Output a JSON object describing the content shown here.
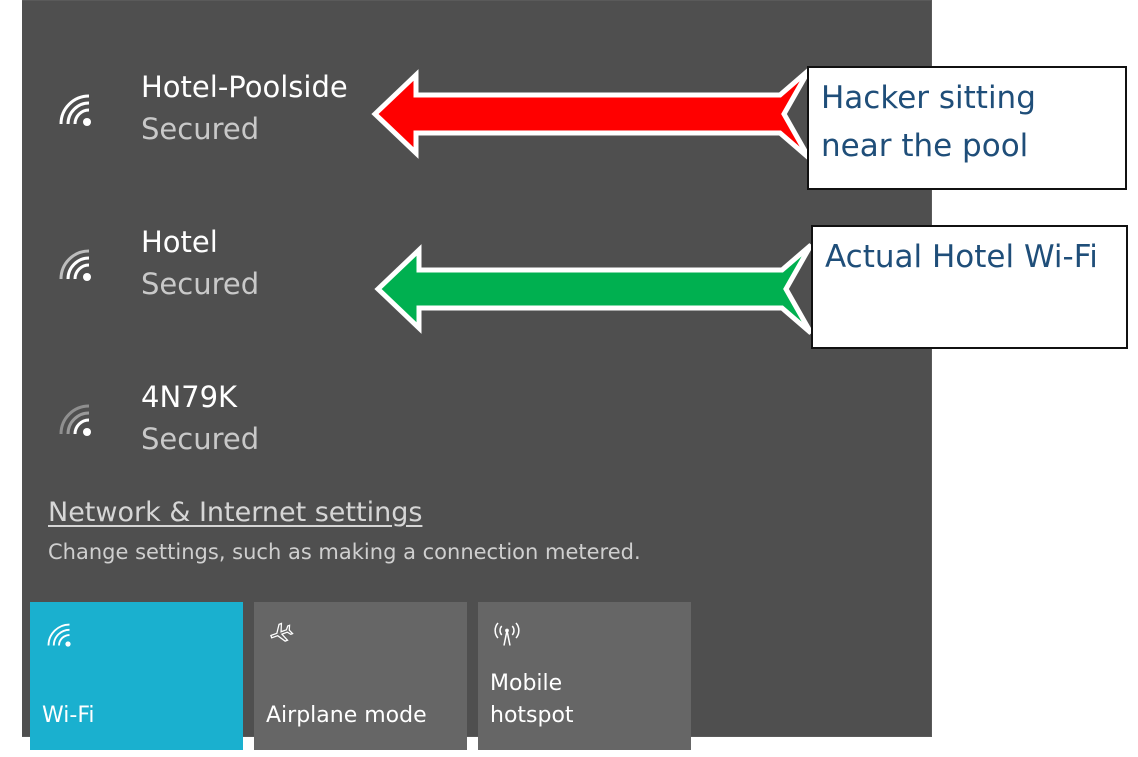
{
  "networks": [
    {
      "name": "Hotel-Poolside",
      "status": "Secured",
      "signal_icon": "wifi-signal-icon"
    },
    {
      "name": "Hotel",
      "status": "Secured",
      "signal_icon": "wifi-signal-icon"
    },
    {
      "name": "4N79K",
      "status": "Secured",
      "signal_icon": "wifi-signal-icon"
    }
  ],
  "settings": {
    "link": "Network & Internet settings",
    "description": "Change settings, such as making a connection metered."
  },
  "quick_actions": [
    {
      "label": "Wi-Fi",
      "icon": "wifi-icon",
      "active": true
    },
    {
      "label": "Airplane mode",
      "icon": "airplane-icon",
      "active": false
    },
    {
      "label": "Mobile\nhotspot",
      "icon": "hotspot-icon",
      "active": false
    }
  ],
  "annotations": {
    "top_callout": "Hacker sitting near the pool",
    "bottom_callout": "Actual Hotel Wi-Fi",
    "top_arrow_color": "#ff0000",
    "bottom_arrow_color": "#00b050"
  },
  "colors": {
    "panel_bg": "#4f4f4f",
    "accent": "#1ab0cf",
    "tile_bg": "#666666",
    "callout_text": "#1f4e79"
  }
}
